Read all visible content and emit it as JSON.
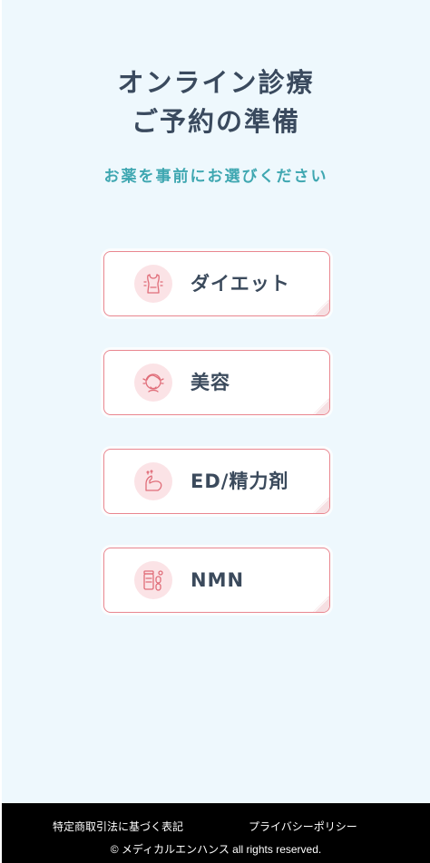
{
  "header": {
    "title_line1": "オンライン診療",
    "title_line2": "ご予約の準備",
    "subtitle": "お薬を事前にお選びください"
  },
  "categories": [
    {
      "label": "ダイエット",
      "icon": "diet-torso-icon"
    },
    {
      "label": "美容",
      "icon": "beauty-face-icon"
    },
    {
      "label": "ED/精力剤",
      "icon": "muscle-arm-icon"
    },
    {
      "label": "NMN",
      "icon": "supplement-bottle-icon"
    }
  ],
  "footer": {
    "link_legal": "特定商取引法に基づく表記",
    "link_privacy": "プライバシーポリシー",
    "copyright": "© メディカルエンハンス all rights reserved."
  },
  "colors": {
    "background": "#eef8fd",
    "title": "#3a4a5e",
    "subtitle": "#3fa7b1",
    "card_border": "#e9868f",
    "icon_bg": "#fbe3e6",
    "icon_stroke": "#e06d79",
    "footer_bg": "#000000"
  }
}
